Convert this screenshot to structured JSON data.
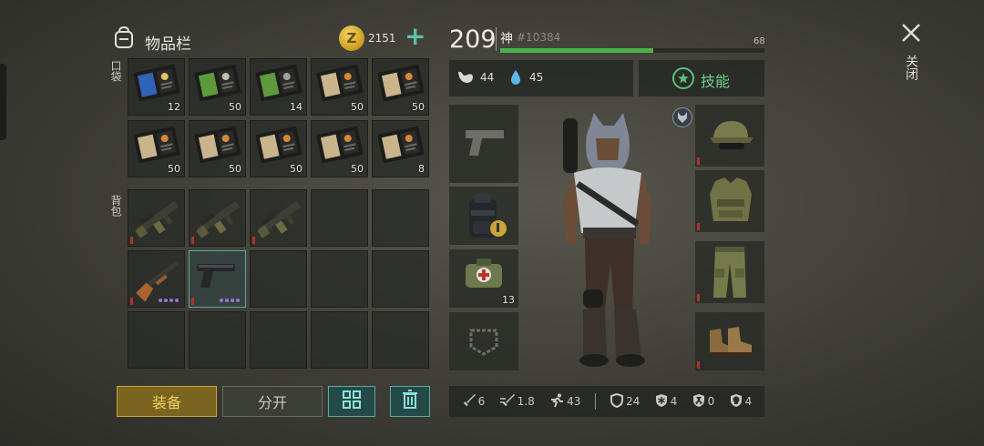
{
  "inventory": {
    "title": "物品栏",
    "coins": "2151",
    "pocket_label": "口袋",
    "backpack_label": "背包",
    "pocket_counts": [
      "12",
      "50",
      "14",
      "50",
      "50",
      "50",
      "50",
      "50",
      "50",
      "8"
    ],
    "equip_button": "装备",
    "split_button": "分开"
  },
  "player": {
    "level": "209",
    "name": "神",
    "id": "#10384",
    "xp_max": "68",
    "xp_fraction": 0.58,
    "food": "44",
    "water": "45",
    "skills_label": "技能",
    "medkit_count": "13"
  },
  "stats": {
    "damage": "6",
    "attack_speed": "1.8",
    "move_speed": "43",
    "defense": "24",
    "cold": "4",
    "radiation": "0",
    "toxic": "4"
  },
  "close_label": "关闭",
  "colors": {
    "accent_teal": "#5fa6a0",
    "xp_green": "#4bb14b",
    "gold": "#c9a438",
    "durability_red": "#b1322b",
    "rarity_purple": "#9a74d8"
  }
}
